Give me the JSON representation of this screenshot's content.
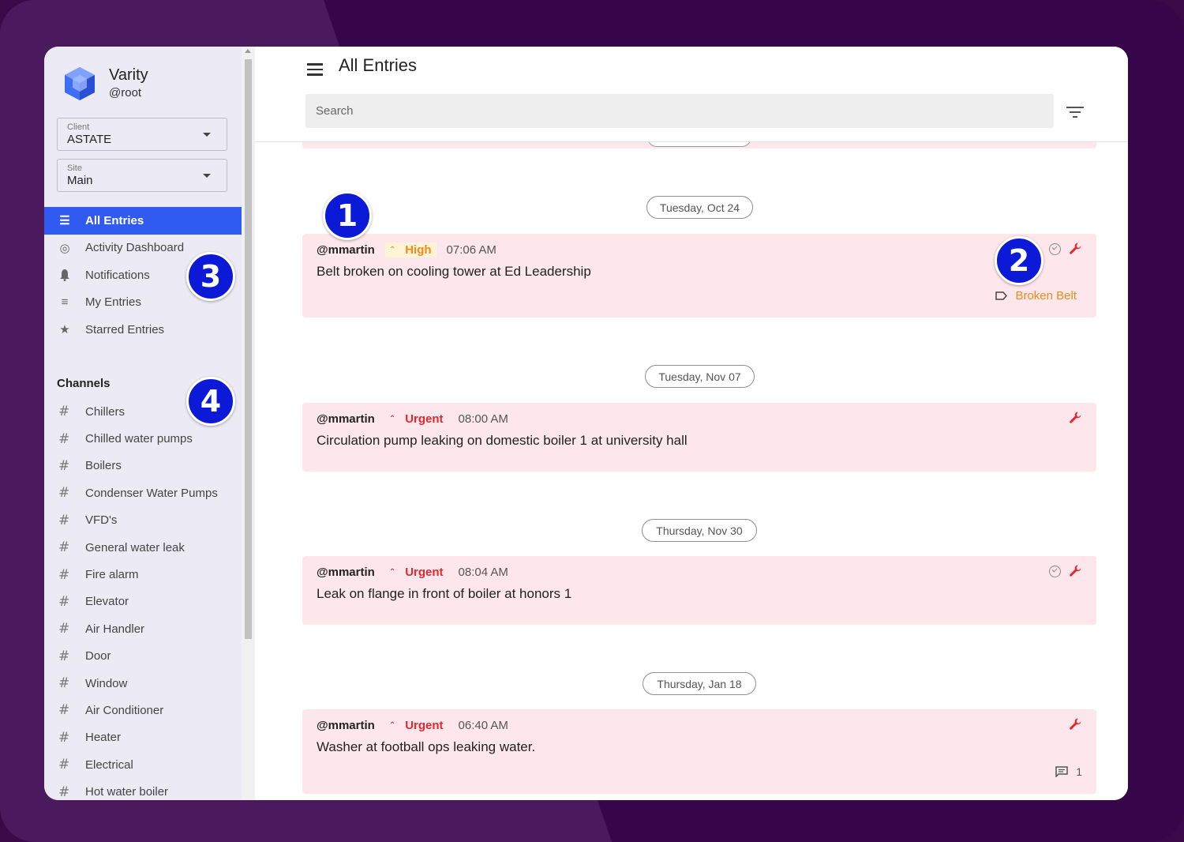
{
  "colors": {
    "background": "#37064a",
    "sidebar": "#ecebf5",
    "accent": "#2f5bf0",
    "entry_background": "#fde7ec",
    "priority_high": "#f08a1a",
    "priority_urgent": "#e0282e",
    "badge": "#0c1ad8"
  },
  "brand": {
    "name": "Varity",
    "handle": "@root",
    "logo_icon": "cube-logo-icon"
  },
  "client_select": {
    "label": "Client",
    "value": "ASTATE"
  },
  "site_select": {
    "label": "Site",
    "value": "Main"
  },
  "nav": {
    "items": [
      {
        "label": "All Entries",
        "icon": "list-icon",
        "glyph": "☰",
        "active": true
      },
      {
        "label": "Activity Dashboard",
        "icon": "broadcast-icon",
        "glyph": "◎",
        "active": false
      },
      {
        "label": "Notifications",
        "icon": "bell-icon",
        "glyph": "🔔",
        "active": false
      },
      {
        "label": "My Entries",
        "icon": "edit-list-icon",
        "glyph": "≡",
        "active": false
      },
      {
        "label": "Starred Entries",
        "icon": "star-icon",
        "glyph": "★",
        "active": false
      }
    ]
  },
  "channels": {
    "title": "Channels",
    "items": [
      "Chillers",
      "Chilled water pumps",
      "Boilers",
      "Condenser Water Pumps",
      "VFD's",
      "General water leak",
      "Fire alarm",
      "Elevator",
      "Air Handler",
      "Door",
      "Window",
      "Air Conditioner",
      "Heater",
      "Electrical",
      "Hot water boiler"
    ]
  },
  "header": {
    "title": "All Entries",
    "search_placeholder": "Search"
  },
  "feed": {
    "groups": [
      {
        "date": "Tuesday, Oct 24",
        "entry": {
          "user": "@mmartin",
          "priority": "High",
          "priority_glyph": "⌃",
          "time": "07:06 AM",
          "text": "Belt broken on cooling tower at Ed Leadership",
          "tag": "Broken Belt",
          "resolved_check": true
        }
      },
      {
        "date": "Tuesday, Nov 07",
        "entry": {
          "user": "@mmartin",
          "priority": "Urgent",
          "priority_glyph": "⌃",
          "time": "08:00 AM",
          "text": "Circulation pump leaking on domestic boiler 1 at university hall"
        }
      },
      {
        "date": "Thursday, Nov 30",
        "entry": {
          "user": "@mmartin",
          "priority": "Urgent",
          "priority_glyph": "⌃",
          "time": "08:04 AM",
          "text": "Leak on flange in front of boiler at honors 1",
          "resolved_check": true
        }
      },
      {
        "date": "Thursday, Jan 18",
        "entry": {
          "user": "@mmartin",
          "priority": "Urgent",
          "priority_glyph": "⌃",
          "time": "06:40 AM",
          "text": "Washer at football ops leaking water.",
          "comment_count": "1"
        }
      }
    ]
  },
  "callouts": [
    "1",
    "2",
    "3",
    "4"
  ]
}
